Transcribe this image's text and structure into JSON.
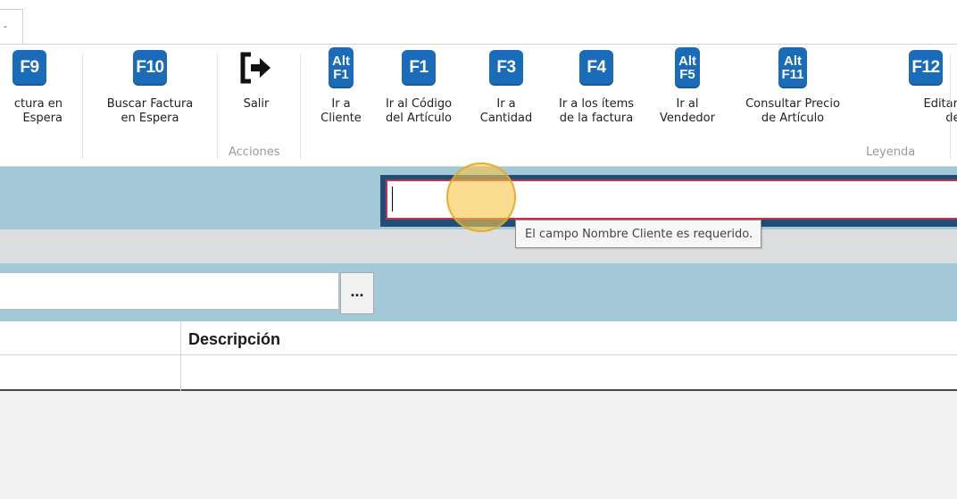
{
  "tab": {
    "label": "-"
  },
  "ribbon": {
    "buttons": [
      {
        "id": "f9",
        "key": "F9",
        "label_lines": [
          "ctura en",
          "Espera"
        ]
      },
      {
        "id": "f10",
        "key": "F10",
        "label_lines": [
          "Buscar Factura",
          "en Espera"
        ]
      },
      {
        "id": "exit",
        "key": "",
        "label_lines": [
          "Salir"
        ]
      },
      {
        "id": "alt-f1",
        "key_lines": [
          "Alt",
          "F1"
        ],
        "label_lines": [
          "Ir a",
          "Cliente"
        ]
      },
      {
        "id": "f1",
        "key": "F1",
        "label_lines": [
          "Ir al Código",
          "del Artículo"
        ]
      },
      {
        "id": "f3",
        "key": "F3",
        "label_lines": [
          "Ir a",
          "Cantidad"
        ]
      },
      {
        "id": "f4",
        "key": "F4",
        "label_lines": [
          "Ir a los ítems",
          "de la factura"
        ]
      },
      {
        "id": "alt-f5",
        "key_lines": [
          "Alt",
          "F5"
        ],
        "label_lines": [
          "Ir al",
          "Vendedor"
        ]
      },
      {
        "id": "alt-f11",
        "key_lines": [
          "Alt",
          "F11"
        ],
        "label_lines": [
          "Consultar Precio",
          "de Artículo"
        ]
      },
      {
        "id": "f12",
        "key": "F12",
        "label_lines": [
          "Editar Descri",
          "de Artícu"
        ]
      }
    ],
    "groups": {
      "acciones": "Acciones",
      "leyenda": "Leyenda"
    }
  },
  "customer": {
    "name_value": "",
    "validation_tooltip": "El campo Nombre Cliente es requerido."
  },
  "article": {
    "code_value": "",
    "browse_label": "..."
  },
  "table": {
    "columns": [
      "",
      "Descripción"
    ],
    "rows": [
      [
        "",
        ""
      ]
    ]
  },
  "colors": {
    "key_blue": "#1a6bb8",
    "band_blue": "#a3c9d8",
    "input_border_red": "#c7324a",
    "cursor_highlight": "#f7c446"
  }
}
